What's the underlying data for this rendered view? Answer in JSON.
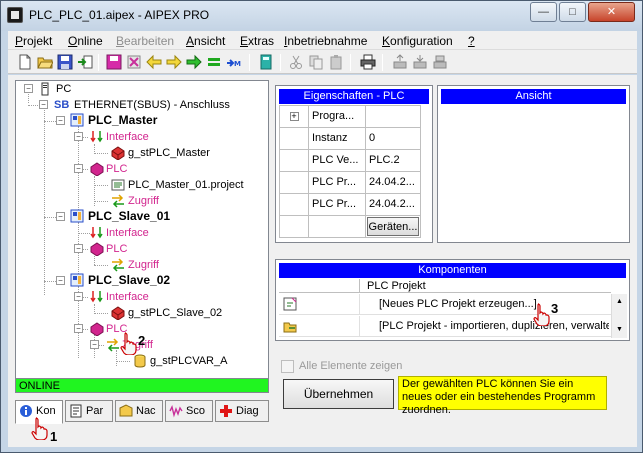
{
  "window": {
    "title": "PLC_PLC_01.aipex - AIPEX PRO",
    "minimize_glyph": "—",
    "maximize_glyph": "□",
    "close_glyph": "✕"
  },
  "menubar": {
    "items": [
      {
        "mnemonic": "P",
        "rest": "rojekt",
        "enabled": true
      },
      {
        "mnemonic": "O",
        "rest": "nline",
        "enabled": true
      },
      {
        "mnemonic": "B",
        "rest": "earbeiten",
        "enabled": false
      },
      {
        "mnemonic": "A",
        "rest": "nsicht",
        "enabled": true
      },
      {
        "mnemonic": "E",
        "rest": "xtras",
        "enabled": true
      },
      {
        "mnemonic": "I",
        "rest": "nbetriebnahme",
        "enabled": true
      },
      {
        "mnemonic": "K",
        "rest": "onfiguration",
        "enabled": true
      },
      {
        "mnemonic": "?",
        "rest": "",
        "enabled": true
      }
    ]
  },
  "tree": {
    "pc": "PC",
    "sb_prefix": "SB",
    "ethernet": "ETHERNET(SBUS) - Anschluss",
    "plc_master": "PLC_Master",
    "interface": "Interface",
    "g_stplc_master": "g_stPLC_Master",
    "plc": "PLC",
    "plc_master_project": "PLC_Master_01.project",
    "zugriff": "Zugriff",
    "plc_slave_01": "PLC_Slave_01",
    "plc_slave_02": "PLC_Slave_02",
    "g_stplc_slave_02": "g_stPLC_Slave_02",
    "g_stplcvar_a": "g_stPLCVAR_A"
  },
  "status": {
    "online": "ONLINE"
  },
  "bottom_tabs": [
    {
      "label": "Kon"
    },
    {
      "label": "Par"
    },
    {
      "label": "Nac"
    },
    {
      "label": "Sco"
    },
    {
      "label": "Diag"
    }
  ],
  "properties": {
    "title": "Eigenschaften - PLC",
    "expand_glyph": "+",
    "rows": [
      {
        "name": "Progra...",
        "value": ""
      },
      {
        "name": "Instanz",
        "value": "0"
      },
      {
        "name": "PLC Ve...",
        "value": "PLC.2"
      },
      {
        "name": "PLC Pr...",
        "value": "24.04.2..."
      },
      {
        "name": "PLC Pr...",
        "value": "24.04.2..."
      }
    ],
    "geraeten_button": "Geräten..."
  },
  "ansicht": {
    "title": "Ansicht"
  },
  "komponenten": {
    "title": "Komponenten",
    "column_header": "PLC Projekt",
    "rows": [
      {
        "text": "[Neues PLC Projekt erzeugen...]"
      },
      {
        "text": "[PLC Projekt - importieren, duplizieren, verwalten]"
      }
    ]
  },
  "alle_elemente": "Alle Elemente zeigen",
  "uebernehmen_button": "Übernehmen",
  "hint_text": "Der gewählten PLC können Sie ein neues oder ein bestehendes Programm zuordnen.",
  "markers": {
    "m1": "1",
    "m2": "2",
    "m3": "3"
  },
  "colors": {
    "title_blue": "#0000ff",
    "online_green": "#20f520",
    "hint_yellow": "#ffff00",
    "tree_pink": "#d2258e"
  }
}
